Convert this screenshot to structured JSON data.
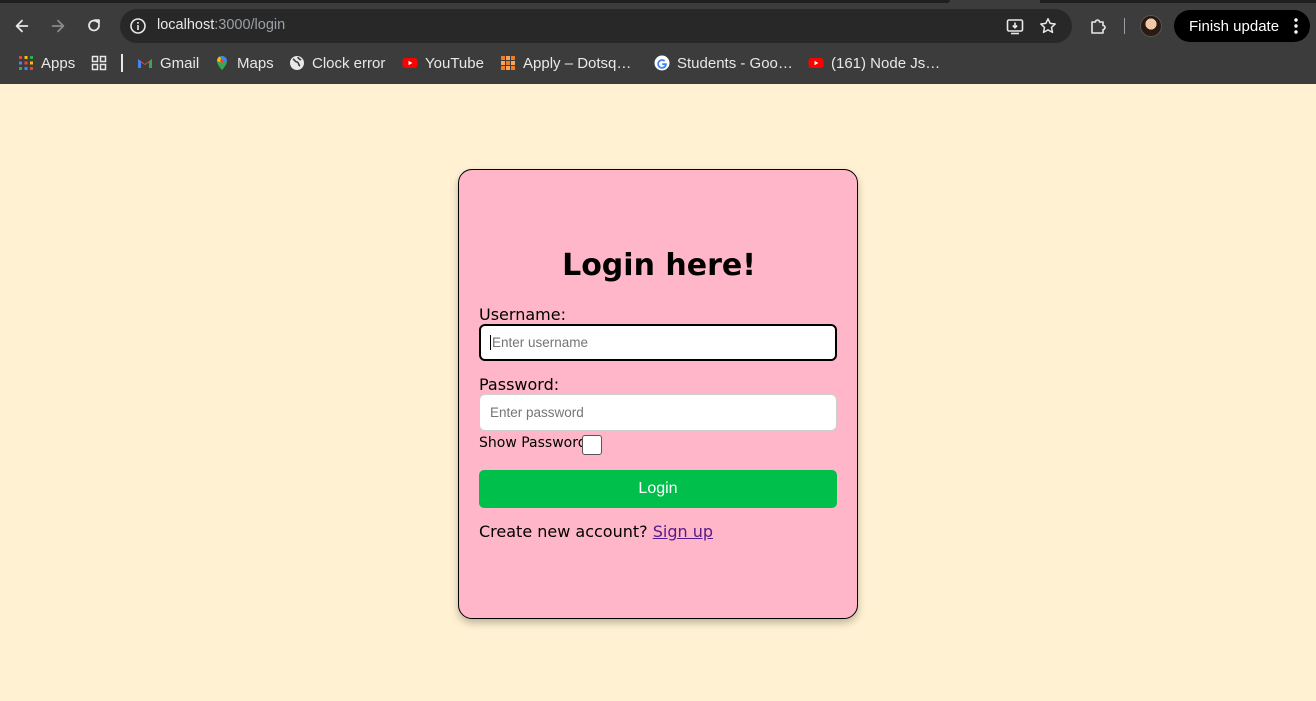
{
  "browser": {
    "url_host": "localhost",
    "url_path": ":3000/login",
    "finish_update_label": "Finish update",
    "icons": {
      "back": "arrow-left-icon",
      "forward": "arrow-right-icon",
      "reload": "reload-icon",
      "site_info": "info-icon",
      "install": "install-app-icon",
      "bookmark": "star-icon",
      "extensions": "puzzle-icon",
      "menu": "vertical-dots-icon"
    }
  },
  "bookmarks": {
    "apps_label": "Apps",
    "items": [
      {
        "label": "Gmail",
        "icon": "gmail-icon"
      },
      {
        "label": "Maps",
        "icon": "maps-icon"
      },
      {
        "label": "Clock error",
        "icon": "globe-icon"
      },
      {
        "label": "YouTube",
        "icon": "youtube-icon"
      },
      {
        "label": "Apply – Dotsq…",
        "icon": "dotsquares-icon"
      },
      {
        "label": "Students - Goo…",
        "icon": "google-icon"
      },
      {
        "label": "(161) Node Js…",
        "icon": "youtube-icon"
      }
    ]
  },
  "login": {
    "title": "Login here!",
    "username_label": "Username:",
    "username_placeholder": "Enter username",
    "password_label": "Password:",
    "password_placeholder": "Enter password",
    "show_password_label": "Show Password",
    "show_password_checked": false,
    "submit_label": "Login",
    "create_account_text": "Create new account?",
    "signup_link": "Sign up"
  },
  "colors": {
    "page_background": "#fff1d2",
    "card_background": "#ffb6c8",
    "login_button": "#00c04b",
    "link": "#551a8b"
  }
}
